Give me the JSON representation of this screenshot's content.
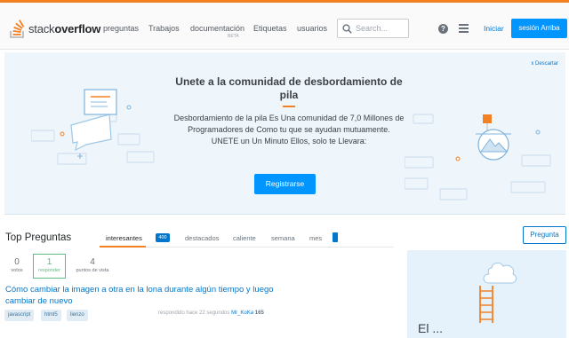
{
  "brand": {
    "prefix": "stack",
    "bold": "overflow"
  },
  "nav": {
    "items": [
      "preguntas",
      "Trabajos",
      "documentación",
      "Etiquetas",
      "usuarios"
    ],
    "doc_badge": "BETA"
  },
  "search": {
    "placeholder": "Search..."
  },
  "header": {
    "help": "?",
    "login_label": "Iniciar",
    "signup_label": "sesión Arriba"
  },
  "hero": {
    "dismiss_label": "x Descartar",
    "title": "Unete a la comunidad de desbordamiento de pila",
    "body": "Desbordamiento de la pila Es Una comunidad de 7,0 Millones de Programadores de Como tu que se ayudan mutuamente. UNETE un Un Minuto Ellos, solo te Llevara:",
    "register_label": "Registrarse"
  },
  "questions": {
    "title": "Top Preguntas",
    "ask_label": "Pregunta",
    "tabs": [
      "interesantes",
      "400",
      "destacados",
      "caliente",
      "semana",
      "mes"
    ],
    "items": [
      {
        "votes": "0",
        "votes_label": "votos",
        "answers": "1",
        "answers_label": "responder",
        "views": "4",
        "views_label": "puntos de vista",
        "title": "Cómo cambiar la imagen a otra en la lona durante algún tiempo y luego cambiar de nuevo",
        "tags": [
          "javascript",
          "html5",
          "lienzo"
        ],
        "meta_prefix": "respondido hace 22 segundos",
        "user": "Mr_KoKa",
        "reputation": "165"
      }
    ]
  },
  "sidebar": {
    "card_text": "El ..."
  },
  "colors": {
    "accent": "#f48024",
    "link": "#0077cc",
    "primary_button": "#0095ff",
    "answered": "#5eba7d"
  }
}
